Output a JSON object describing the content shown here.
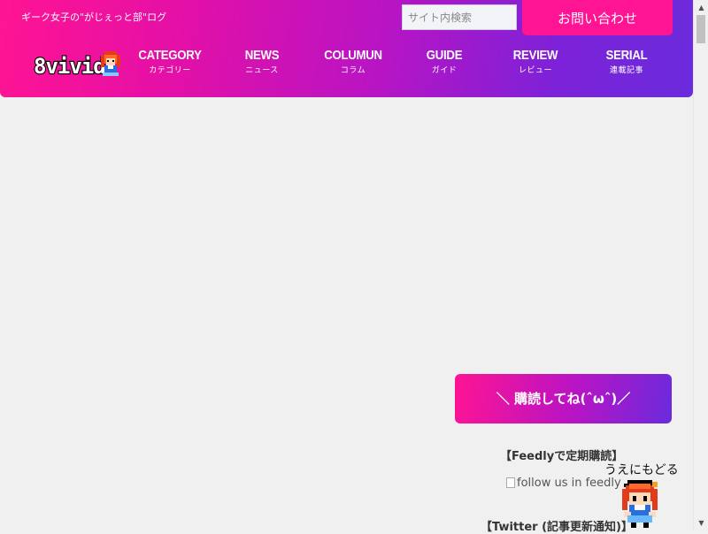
{
  "header": {
    "tagline": "ギーク女子の\"がじぇっと部\"ログ",
    "search_placeholder": "サイト内検索",
    "contact_label": "お問い合わせ",
    "logo_text": "8vivid"
  },
  "nav": [
    {
      "label": "CATEGORY",
      "sub": "カテゴリー"
    },
    {
      "label": "NEWS",
      "sub": "ニュース"
    },
    {
      "label": "COLUMUN",
      "sub": "コラム"
    },
    {
      "label": "GUIDE",
      "sub": "ガイド"
    },
    {
      "label": "REVIEW",
      "sub": "レビュー"
    },
    {
      "label": "SERIAL",
      "sub": "連載記事"
    }
  ],
  "sidebar": {
    "subscribe_banner": "＼ 購読してね(ˆωˆ)／",
    "feedly_heading": "【Feedlyで定期購読】",
    "feedly_alt": "follow us in feedly",
    "twitter_heading": "【Twitter (記事更新通知)】"
  },
  "back_to_top": {
    "label": "うえにもどる"
  },
  "colors": {
    "accent_pink": "#ff1493",
    "accent_purple": "#6a2bdc"
  }
}
